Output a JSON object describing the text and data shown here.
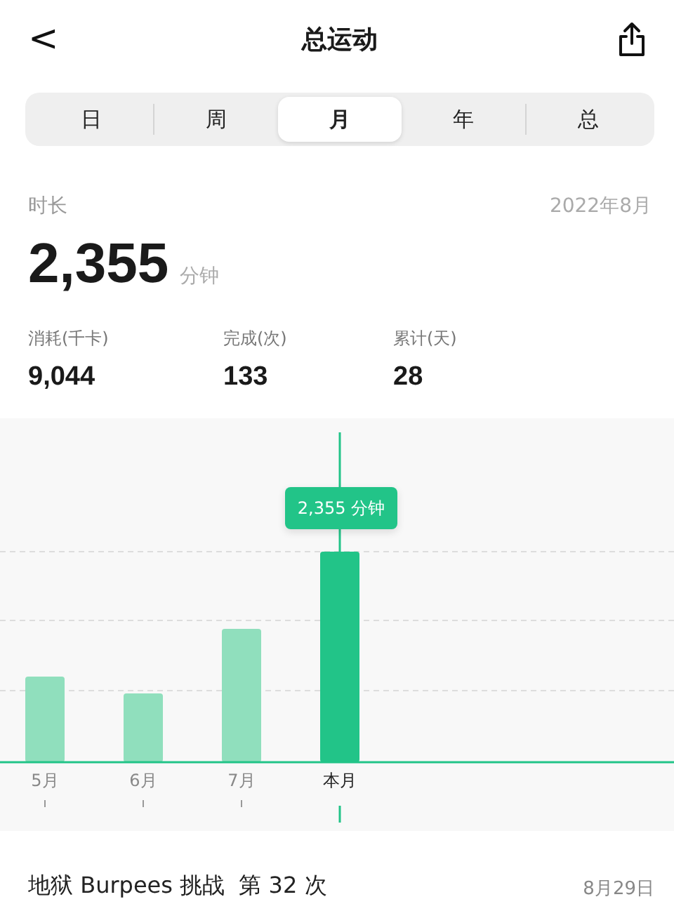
{
  "header": {
    "back": "<",
    "title": "总运动"
  },
  "tabs": [
    {
      "label": "日",
      "selected": false
    },
    {
      "label": "周",
      "selected": false
    },
    {
      "label": "月",
      "selected": true
    },
    {
      "label": "年",
      "selected": false
    },
    {
      "label": "总",
      "selected": false
    }
  ],
  "summary": {
    "label": "时长",
    "period": "2022年8月",
    "value": "2,355",
    "unit": "分钟"
  },
  "stats": [
    {
      "label": "消耗(千卡)",
      "value": "9,044"
    },
    {
      "label": "完成(次)",
      "value": "133"
    },
    {
      "label": "累计(天)",
      "value": "28"
    }
  ],
  "chart": {
    "tooltip": "2,355 分钟",
    "categories": [
      {
        "label": "5月",
        "selected": false
      },
      {
        "label": "6月",
        "selected": false
      },
      {
        "label": "7月",
        "selected": false
      },
      {
        "label": "本月",
        "selected": true
      }
    ]
  },
  "record": {
    "title": "地狱 Burpees 挑战",
    "count": "第 32 次",
    "date": "8月29日"
  }
}
